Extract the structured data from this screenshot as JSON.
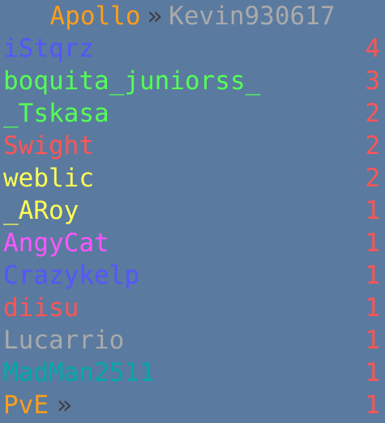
{
  "header": {
    "brand": "Apollo",
    "separator": "»",
    "player": "Kevin930617"
  },
  "entries": [
    {
      "name": "iStqrz",
      "score": "4",
      "color": "#5555ff"
    },
    {
      "name": "boquita_juniorss_",
      "score": "3",
      "color": "#55ff55"
    },
    {
      "name": "_Tskasa",
      "score": "2",
      "color": "#55ff55"
    },
    {
      "name": "Swight",
      "score": "2",
      "color": "#ff5555"
    },
    {
      "name": "weblic",
      "score": "2",
      "color": "#ffff55"
    },
    {
      "name": "_ARoy",
      "score": "1",
      "color": "#ffff55"
    },
    {
      "name": "AngyCat",
      "score": "1",
      "color": "#ff55ff"
    },
    {
      "name": "Crazykelp",
      "score": "1",
      "color": "#5555ff"
    },
    {
      "name": "diisu",
      "score": "1",
      "color": "#ff5555"
    },
    {
      "name": "Lucarrio",
      "score": "1",
      "color": "#aaaaaa"
    },
    {
      "name": "MadMan2511",
      "score": "1",
      "color": "#00aaaa"
    }
  ],
  "footer": {
    "label": "PvE",
    "separator": "»",
    "score": "1",
    "color": "#ff9e1a"
  },
  "colors": {
    "background": "#5a7aa0",
    "score": "#ff5555"
  }
}
